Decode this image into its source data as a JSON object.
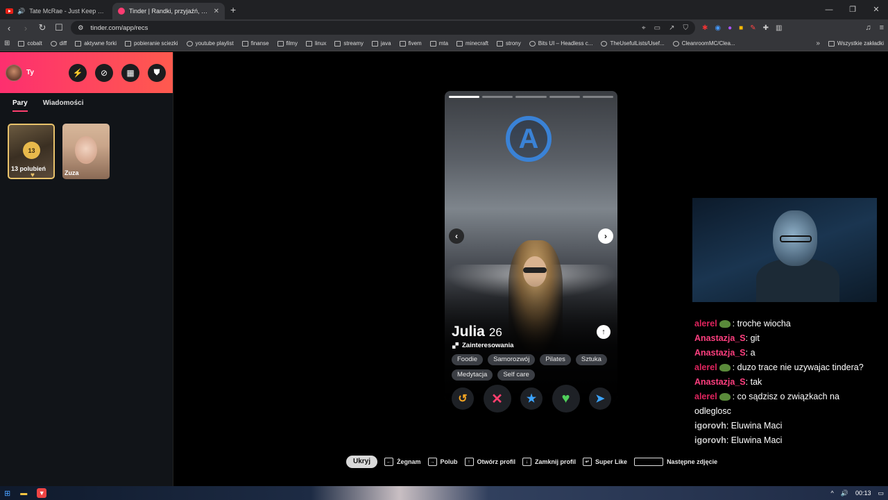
{
  "browser": {
    "tabs": [
      {
        "title": "Tate McRae - Just Keep Watching",
        "active": false
      },
      {
        "title": "Tinder | Randki, przyjaźń, nowe z",
        "active": true
      }
    ],
    "url": "tinder.com/app/recs",
    "bookmarks": [
      {
        "label": "cobalt"
      },
      {
        "label": "diff"
      },
      {
        "label": "aktywne forki"
      },
      {
        "label": "pobieranie sciezki"
      },
      {
        "label": "youtube playlist"
      },
      {
        "label": "finanse"
      },
      {
        "label": "filmy"
      },
      {
        "label": "linux"
      },
      {
        "label": "streamy"
      },
      {
        "label": "java"
      },
      {
        "label": "fivem"
      },
      {
        "label": "mta"
      },
      {
        "label": "minecraft"
      },
      {
        "label": "strony"
      },
      {
        "label": "Bits UI – Headless c..."
      },
      {
        "label": "TheUsefulLists/Usef..."
      },
      {
        "label": "CleanroomMC/Clea..."
      }
    ],
    "bookmarks_all": "Wszystkie zakładki"
  },
  "sidebar": {
    "user_name": "Ty",
    "tabs": {
      "matches": "Pary",
      "messages": "Wiadomości"
    },
    "likes": {
      "count": "13",
      "label": "13 polubień"
    },
    "matches": [
      {
        "name": "Zuza"
      }
    ]
  },
  "profile": {
    "name": "Julia",
    "age": "26",
    "interests_label": "Zainteresowania",
    "tags": [
      "Foodie",
      "Samorozwój",
      "Pilates",
      "Sztuka",
      "Medytacja",
      "Self care"
    ],
    "photo_count": 5,
    "active_photo": 1
  },
  "hints": {
    "hide": "Ukryj",
    "items": [
      {
        "label": "Żegnam",
        "key": "←"
      },
      {
        "label": "Polub",
        "key": "→"
      },
      {
        "label": "Otwórz profil",
        "key": "↑"
      },
      {
        "label": "Zamknij profil",
        "key": "↓"
      },
      {
        "label": "Super Like",
        "key": "↵"
      },
      {
        "label": "Następne zdjęcie",
        "key": ""
      }
    ]
  },
  "chat": [
    {
      "user": "alerel",
      "color": "#e0245e",
      "emote": true,
      "text": ": troche wiocha"
    },
    {
      "user": "Anastazja_S",
      "color": "#ff3f7f",
      "emote": false,
      "text": ": git"
    },
    {
      "user": "Anastazja_S",
      "color": "#ff3f7f",
      "emote": false,
      "text": ": a"
    },
    {
      "user": "alerel",
      "color": "#e0245e",
      "emote": true,
      "text": ": duzo trace nie uzywajac tindera?"
    },
    {
      "user": "Anastazja_S",
      "color": "#ff3f7f",
      "emote": false,
      "text": ": tak"
    },
    {
      "user": "alerel",
      "color": "#e0245e",
      "emote": true,
      "text": ": co sądzisz o związkach na"
    },
    {
      "user": "",
      "color": "#ffffff",
      "emote": false,
      "text": "odleglosc"
    },
    {
      "user": "igorovh",
      "color": "#c8c8c8",
      "emote": false,
      "text": ": Eluwina Maci"
    },
    {
      "user": "igorovh",
      "color": "#c8c8c8",
      "emote": false,
      "text": ": Eluwina Maci"
    }
  ],
  "taskbar": {
    "time": "00:13"
  },
  "colors": {
    "tinder_pink": "#fd2f6f",
    "tinder_orange": "#ff5a4e",
    "gold": "#e8c26b"
  }
}
